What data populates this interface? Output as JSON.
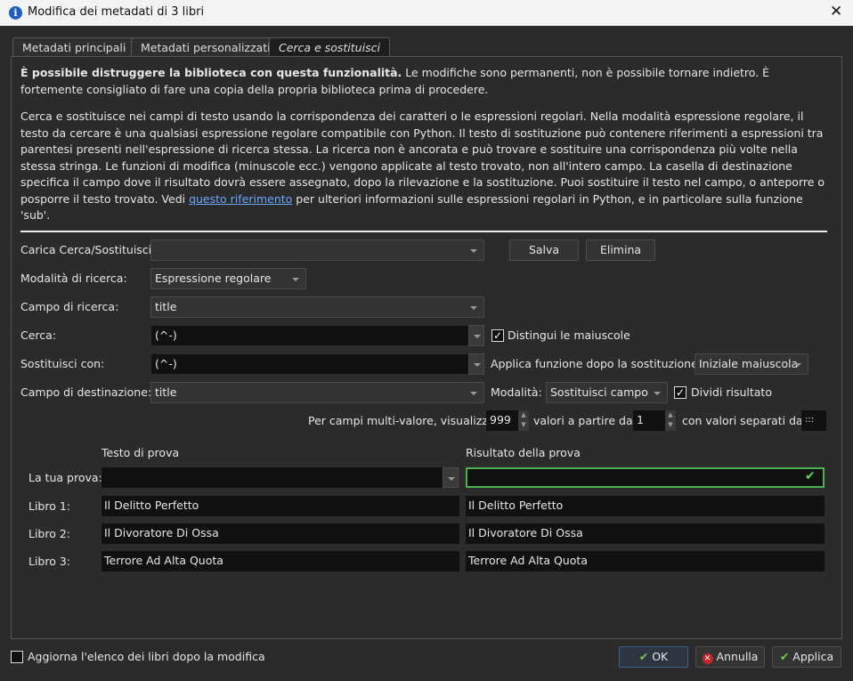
{
  "window": {
    "title": "Modifica dei metadati di 3 libri",
    "close": "✕"
  },
  "tabs": [
    {
      "label": "Metadati principali"
    },
    {
      "label": "Metadati personalizzati"
    },
    {
      "label": "Cerca e sostituisci"
    }
  ],
  "warning": {
    "bold": "È possibile distruggere la biblioteca con questa funzionalità.",
    "text": " Le modifiche sono permanenti, non è possibile tornare indietro. È fortemente consigliato di fare una copia della propria biblioteca prima di procedere."
  },
  "description": {
    "text": "Cerca e sostituisce nei campi di testo usando la corrispondenza dei caratteri o le espressioni regolari. Nella modalità espressione regolare, il testo da cercare è una qualsiasi espressione regolare compatibile con Python. Il testo di sostituzione può contenere riferimenti a espressioni tra parentesi presenti nell'espressione di ricerca stessa. La ricerca non è ancorata e può trovare e sostituire una corrispondenza più volte nella stessa stringa. Le funzioni di modifica (minuscole ecc.) vengono applicate al testo trovato, non all'intero campo. La casella di destinazione specifica il campo dove il risultato dovrà essere assegnato, dopo la rilevazione e la sostituzione. Puoi sostituire il testo nel campo, o anteporre o posporre il testo trovato. Vedi ",
    "link": "questo riferimento",
    "after": " per ulteriori informazioni sulle espressioni regolari in Python, e in particolare sulla funzione 'sub'."
  },
  "form": {
    "load_label": "Carica Cerca/Sostituisci:",
    "load_value": "",
    "save": "Salva",
    "delete": "Elimina",
    "mode_label": "Modalità di ricerca:",
    "mode_value": "Espressione regolare",
    "search_field_label": "Campo di ricerca:",
    "search_field_value": "title",
    "search_label": "Cerca:",
    "search_value": "(^-)",
    "case_label": "Distingui le maiuscole",
    "case_checked": true,
    "replace_label": "Sostituisci con:",
    "replace_value": "(^-)",
    "func_label": "Applica funzione dopo la sostituzione:",
    "func_value": "Iniziale maiuscola",
    "dest_label": "Campo di destinazione:",
    "dest_value": "title",
    "dmode_label": "Modalità:",
    "dmode_value": "Sostituisci campo",
    "split_label": "Dividi risultato",
    "split_checked": true,
    "multi_label": "Per campi multi-valore, visualizza",
    "multi_count": "999",
    "start_label": "valori a partire da",
    "start_value": "1",
    "sep_label": "con valori separati da",
    "sep_value": ":::"
  },
  "test": {
    "header_left": "Testo di prova",
    "header_right": "Risultato della prova",
    "your_test": "La tua prova:",
    "your_test_value": "",
    "result_value": "",
    "rows": [
      {
        "label": "Libro 1:",
        "input": "Il Delitto Perfetto",
        "result": "Il Delitto Perfetto"
      },
      {
        "label": "Libro 2:",
        "input": "Il Divoratore Di Ossa",
        "result": "Il Divoratore Di Ossa"
      },
      {
        "label": "Libro 3:",
        "input": "Terrore Ad Alta Quota",
        "result": "Terrore Ad Alta Quota"
      }
    ]
  },
  "footer": {
    "refresh_label": "Aggiorna l'elenco dei libri dopo la modifica",
    "ok": "OK",
    "cancel": "Annulla",
    "apply": "Applica"
  }
}
